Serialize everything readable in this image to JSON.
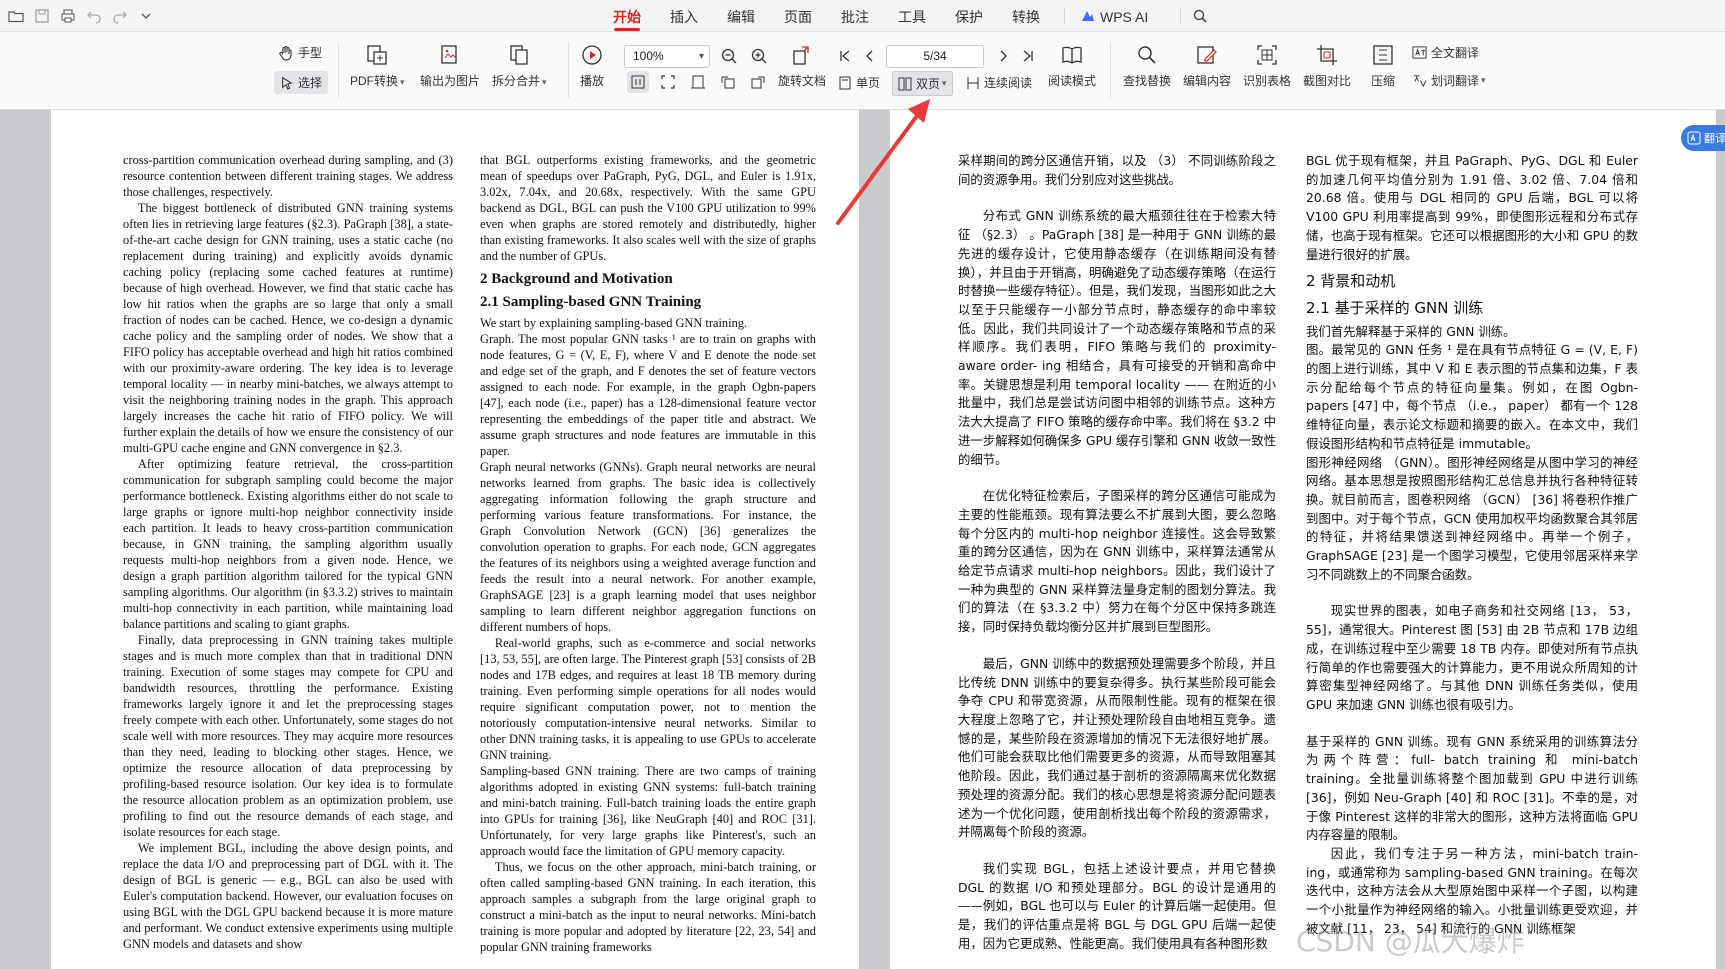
{
  "menu": {
    "items": [
      "开始",
      "插入",
      "编辑",
      "页面",
      "批注",
      "工具",
      "保护",
      "转换"
    ],
    "wps_ai": "WPS AI"
  },
  "toolbar": {
    "hand": "手型",
    "select": "选择",
    "pdf_convert": "PDF转换",
    "export_image": "输出为图片",
    "split_merge": "拆分合并",
    "play": "播放",
    "zoom": "100%",
    "page": "5/34",
    "rotate": "旋转文档",
    "single": "单页",
    "double": "双页",
    "continuous": "连续阅读",
    "reading_mode": "阅读模式",
    "find_replace": "查找替换",
    "edit_content": "编辑内容",
    "recognize_table": "识别表格",
    "screenshot_compare": "截图对比",
    "compress": "压缩",
    "full_translate": "全文翻译",
    "word_translate": "划词翻译"
  },
  "float_button": "翻译",
  "watermark": "CSDN @瓜大爆炸",
  "left_col1": [
    "cross-partition communication overhead during sampling, and (3) resource contention between different training stages. We address those challenges, respectively.",
    "The biggest bottleneck of distributed GNN training systems often lies in retrieving large features (§2.3). PaGraph [38], a state-of-the-art cache design for GNN training, uses a static cache (no replacement during training) and explicitly avoids dynamic caching policy (replacing some cached features at runtime) because of high overhead. However, we find that static cache has low hit ratios when the graphs are so large that only a small fraction of nodes can be cached. Hence, we co-design a dynamic cache policy and the sampling order of nodes. We show that a FIFO policy has acceptable overhead and high hit ratios combined with our proximity-aware ordering. The key idea is to leverage temporal locality — in nearby mini-batches, we always attempt to visit the neighboring training nodes in the graph. This approach largely increases the cache hit ratio of FIFO policy. We will further explain the details of how we ensure the consistency of our multi-GPU cache engine and GNN convergence in §2.3.",
    "After optimizing feature retrieval, the cross-partition communication for subgraph sampling could become the major performance bottleneck. Existing algorithms either do not scale to large graphs or ignore multi-hop neighbor connectivity inside each partition. It leads to heavy cross-partition communication because, in GNN training, the sampling algorithm usually requests multi-hop neighbors from a given node. Hence, we design a graph partition algorithm tailored for the typical GNN sampling algorithms. Our algorithm (in §3.3.2) strives to maintain multi-hop connectivity in each partition, while maintaining load balance partitions and scaling to giant graphs.",
    "Finally, data preprocessing in GNN training takes multiple stages and is much more complex than that in traditional DNN training. Execution of some stages may compete for CPU and bandwidth resources, throttling the performance. Existing frameworks largely ignore it and let the preprocessing stages freely compete with each other. Unfortunately, some stages do not scale well with more resources. They may acquire more resources than they need, leading to blocking other stages. Hence, we optimize the resource allocation of data preprocessing by profiling-based resource isolation. Our key idea is to formulate the resource allocation problem as an optimization problem, use profiling to find out the resource demands of each stage, and isolate resources for each stage.",
    "We implement BGL, including the above design points, and replace the data I/O and preprocessing part of DGL with it. The design of BGL is generic — e.g., BGL can also be used with Euler's computation backend. However, our evaluation focuses on using BGL with the DGL GPU backend because it is more mature and performant. We conduct extensive experiments using multiple GNN models and datasets and show"
  ],
  "left_col2_intro": "that BGL outperforms existing frameworks, and the geometric mean of speedups over PaGraph, PyG, DGL, and Euler is 1.91x, 3.02x, 7.04x, and 20.68x, respectively. With the same GPU backend as DGL, BGL can push the V100 GPU utilization to 99% even when graphs are stored remotely and distributedly, higher than existing frameworks. It also scales well with the size of graphs and the number of GPUs.",
  "left_col2_h2": "2   Background and Motivation",
  "left_col2_h21": "2.1   Sampling-based GNN Training",
  "left_col2_rest": [
    "We start by explaining sampling-based GNN training.",
    "Graph. The most popular GNN tasks ¹ are to train on graphs with node features, G = (V, E, F), where V and E denote the node set and edge set of the graph, and F denotes the set of feature vectors assigned to each node. For example, in the graph Ogbn-papers [47], each node (i.e., paper) has a 128-dimensional feature vector representing the embeddings of the paper title and abstract. We assume graph structures and node features are immutable in this paper.",
    "Graph neural networks (GNNs). Graph neural networks are neural networks learned from graphs. The basic idea is collectively aggregating information following the graph structure and performing various feature transformations. For instance, the Graph Convolution Network (GCN) [36] generalizes the convolution operation to graphs. For each node, GCN aggregates the features of its neighbors using a weighted average function and feeds the result into a neural network. For another example, GraphSAGE [23] is a graph learning model that uses neighbor sampling to learn different neighbor aggregation functions on different numbers of hops.",
    "Real-world graphs, such as e-commerce and social networks [13, 53, 55], are often large. The Pinterest graph [53] consists of 2B nodes and 17B edges, and requires at least 18 TB memory during training. Even performing simple operations for all nodes would require significant computation power, not to mention the notoriously computation-intensive neural networks. Similar to other DNN training tasks, it is appealing to use GPUs to accelerate GNN training.",
    "Sampling-based GNN training. There are two camps of training algorithms adopted in existing GNN systems: full-batch training and mini-batch training. Full-batch training loads the entire graph into GPUs for training [36], like NeuGraph [40] and ROC [31]. Unfortunately, for very large graphs like Pinterest's, such an approach would face the limitation of GPU memory capacity.",
    "Thus, we focus on the other approach, mini-batch training, or often called sampling-based GNN training. In each iteration, this approach samples a subgraph from the large original graph to construct a mini-batch as the input to neural networks. Mini-batch training is more popular and adopted by literature [22, 23, 54] and popular GNN training frameworks"
  ],
  "right_col1": [
    "采样期间的跨分区通信开销，以及 （3） 不同训练阶段之间的资源争用。我们分别应对这些挑战。",
    "分布式 GNN 训练系统的最大瓶颈往往在于检索大特征 （§2.3） 。PaGraph [38] 是一种用于 GNN 训练的最先进的缓存设计，它使用静态缓存（在训练期间没有替换），并且由于开销高，明确避免了动态缓存策略（在运行时替换一些缓存特征）。但是，我们发现，当图形如此之大以至于只能缓存一小部分节点时，静态缓存的命中率较低。因此，我们共同设计了一个动态缓存策略和节点的采样顺序。我们表明，FIFO 策略与我们的 proximity-aware order- ing 相结合，具有可接受的开销和高命中率。关键思想是利用 temporal locality —— 在附近的小批量中，我们总是尝试访问图中相邻的训练节点。这种方法大大提高了 FIFO 策略的缓存命中率。我们将在 §3.2 中进一步解释如何确保多 GPU 缓存引擎和 GNN 收敛一致性的细节。",
    "在优化特征检索后，子图采样的跨分区通信可能成为主要的性能瓶颈。现有算法要么不扩展到大图，要么忽略每个分区内的 multi-hop neighbor 连接性。这会导致繁重的跨分区通信，因为在 GNN 训练中，采样算法通常从给定节点请求 multi-hop neighbors。因此，我们设计了一种为典型的 GNN 采样算法量身定制的图划分算法。我们的算法（在 §3.3.2 中）努力在每个分区中保持多跳连接，同时保持负载均衡分区并扩展到巨型图形。",
    "最后，GNN 训练中的数据预处理需要多个阶段，并且比传统 DNN 训练中的要复杂得多。执行某些阶段可能会争夺 CPU 和带宽资源，从而限制性能。现有的框架在很大程度上忽略了它，并让预处理阶段自由地相互竞争。遗憾的是，某些阶段在资源增加的情况下无法很好地扩展。他们可能会获取比他们需要更多的资源，从而导致阻塞其他阶段。因此，我们通过基于剖析的资源隔离来优化数据预处理的资源分配。我们的核心思想是将资源分配问题表述为一个优化问题，使用剖析找出每个阶段的资源需求，并隔离每个阶段的资源。",
    "我们实现 BGL，包括上述设计要点，并用它替换 DGL 的数据 I/O 和预处理部分。BGL 的设计是通用的——例如，BGL 也可以与 Euler 的计算后端一起使用。但是，我们的评估重点是将 BGL 与 DGL GPU 后端一起使用，因为它更成熟、性能更高。我们使用具有各种图形数"
  ],
  "right_col2_intro": "BGL 优于现有框架，并且 PaGraph、PyG、DGL 和 Euler 的加速几何平均值分别为 1.91 倍、3.02 倍、7.04 倍和 20.68 倍。使用与 DGL 相同的 GPU 后端，BGL 可以将 V100 GPU 利用率提高到 99%，即使图形远程和分布式存储，也高于现有框架。它还可以根据图形的大小和 GPU 的数量进行很好的扩展。",
  "right_col2_h2": "2 背景和动机",
  "right_col2_h21": "2.1 基于采样的 GNN 训练",
  "right_col2_rest": [
    "我们首先解释基于采样的 GNN 训练。",
    "图。最常见的 GNN 任务 ¹ 是在具有节点特征 G = (V, E, F) 的图上进行训练，其中 V 和 E 表示图的节点集和边集，F 表示分配给每个节点的特征向量集。例如，在图 Ogbn-papers [47] 中，每个节点 （i.e.， paper） 都有一个 128 维特征向量，表示论文标题和摘要的嵌入。在本文中，我们假设图形结构和节点特征是 immutable。",
    "图形神经网络 （GNN）。图形神经网络是从图中学习的神经网络。基本思想是按照图形结构汇总信息并执行各种特征转换。就目前而言，图卷积网络 （GCN） [36] 将卷积作推广到图中。对于每个节点，GCN 使用加权平均函数聚合其邻居的特征，并将结果馈送到神经网络中。再举一个例子，GraphSAGE [23] 是一个图学习模型，它使用邻居采样来学习不同跳数上的不同聚合函数。",
    "现实世界的图表，如电子商务和社交网络 [13， 53， 55]，通常很大。Pinterest 图 [53] 由 2B 节点和 17B 边组成，在训练过程中至少需要 18 TB 内存。即使对所有节点执行简单的作也需要强大的计算能力，更不用说众所周知的计算密集型神经网络了。与其他 DNN 训练任务类似，使用 GPU 来加速 GNN 训练也很有吸引力。",
    "基于采样的 GNN 训练。现有 GNN 系统采用的训练算法分为两个阵营：full- batch training 和 mini-batch training。全批量训练将整个图加载到 GPU 中进行训练 [36]，例如 Neu-Graph [40] 和 ROC [31]。不幸的是，对于像 Pinterest 这样的非常大的图形，这种方法将面临 GPU 内存容量的限制。",
    "因此，我们专注于另一种方法，mini-batch train- ing，或通常称为 sampling-based GNN training。在每次迭代中，这种方法会从大型原始图中采样一个子图，以构建一个小批量作为神经网络的输入。小批量训练更受欢迎，并被文献 [11， 23， 54] 和流行的 GNN 训练框架"
  ]
}
